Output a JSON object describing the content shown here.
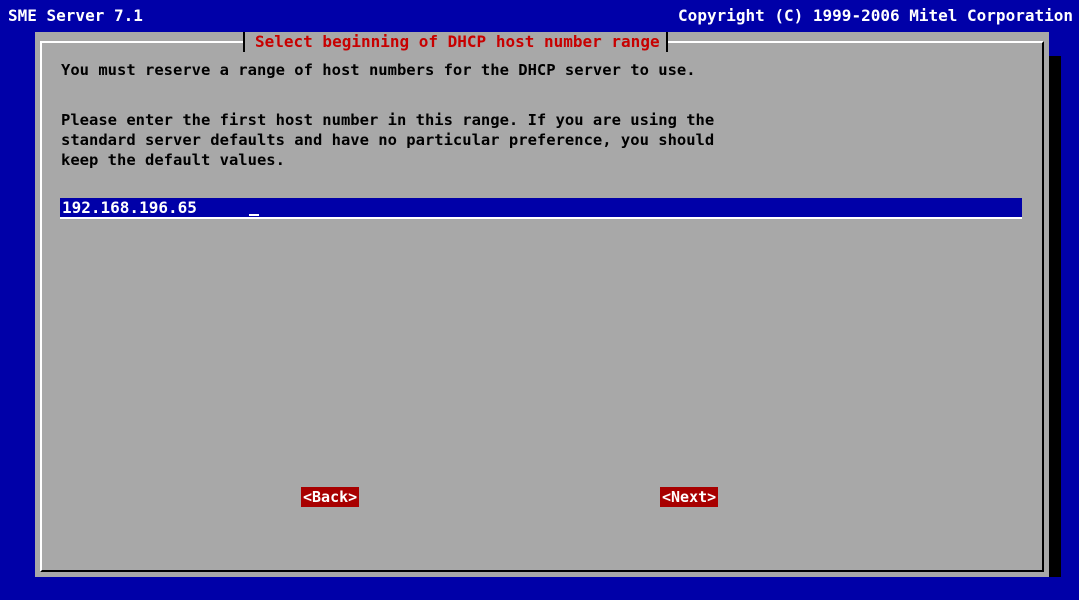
{
  "title_bar": {
    "left": "SME Server 7.1",
    "right": "Copyright (C) 1999-2006 Mitel Corporation"
  },
  "dialog": {
    "title": "Select beginning of DHCP host number range",
    "intro": "You must reserve a range of host numbers for the DHCP server to use.",
    "paragraph_lines": [
      "Please enter the first host number in this range. If you are using the",
      "standard server defaults and have no particular preference, you should",
      "keep the default values."
    ],
    "input_value": "192.168.196.65",
    "buttons": {
      "back": "<Back>",
      "next": "<Next>"
    }
  },
  "colors": {
    "screen_background": "#0000a8",
    "dialog_background": "#a8a8a8",
    "title_text": "#c80000",
    "button_background": "#a80000",
    "input_background": "#0000a8"
  }
}
